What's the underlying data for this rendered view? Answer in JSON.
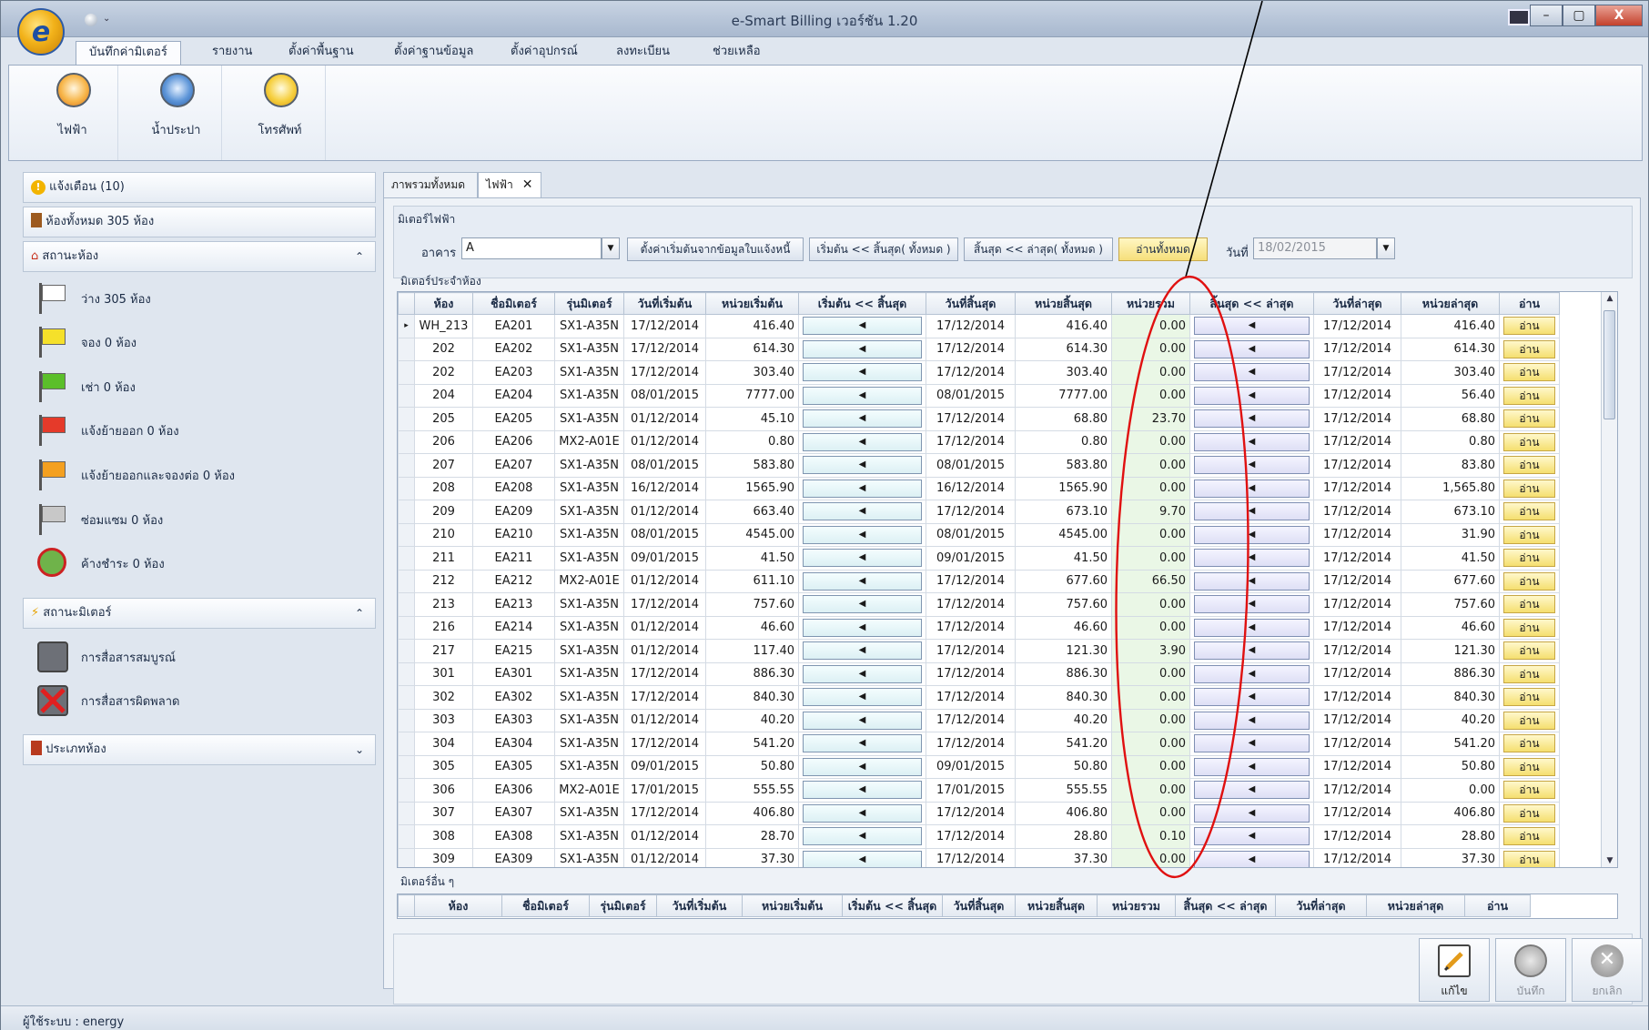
{
  "window": {
    "title": "e-Smart Billing เวอร์ชัน 1.20",
    "controls": {
      "minimize": "–",
      "maximize": "▢",
      "close": "X"
    }
  },
  "ribbon": {
    "tabs": [
      "บันทึกค่ามิเตอร์",
      "รายงาน",
      "ตั้งค่าพื้นฐาน",
      "ตั้งค่าฐานข้อมูล",
      "ตั้งค่าอุปกรณ์",
      "ลงทะเบียน",
      "ช่วยเหลือ"
    ],
    "buttons": [
      {
        "label": "ไฟฟ้า",
        "icon": "electric-meter-icon"
      },
      {
        "label": "น้ำประปา",
        "icon": "water-meter-icon"
      },
      {
        "label": "โทรศัพท์",
        "icon": "phone-meter-icon"
      }
    ]
  },
  "left": {
    "alerts": "แจ้งเตือน (10)",
    "rooms_total": "ห้องทั้งหมด 305 ห้อง",
    "room_status": {
      "title": "สถานะห้อง",
      "items": [
        {
          "label": "ว่าง 305 ห้อง",
          "color": "#ffffff"
        },
        {
          "label": "จอง 0 ห้อง",
          "color": "#f5e02a"
        },
        {
          "label": "เช่า 0 ห้อง",
          "color": "#5bbf2a"
        },
        {
          "label": "แจ้งย้ายออก 0 ห้อง",
          "color": "#e53a2a"
        },
        {
          "label": "แจ้งย้ายออกและจองต่อ 0 ห้อง",
          "color": "#f4a020"
        },
        {
          "label": "ซ่อมแซม 0 ห้อง",
          "color": "#c8c8c8"
        },
        {
          "label": "ค้างชำระ 0 ห้อง",
          "color": "#cc2222"
        }
      ]
    },
    "meter_status": {
      "title": "สถานะมิเตอร์",
      "items": [
        {
          "label": "การสื่อสารสมบูรณ์"
        },
        {
          "label": "การสื่อสารผิดพลาด"
        }
      ]
    },
    "room_type": {
      "title": "ประเภทห้อง"
    }
  },
  "doc_tabs": [
    {
      "label": "ภาพรวมทั้งหมด"
    },
    {
      "label": "ไฟฟ้า",
      "close": "✕"
    }
  ],
  "meter_panel": {
    "group_title": "มิเตอร์ไฟฟ้า",
    "building_label": "อาคาร",
    "building_value": "A",
    "btn_init": "ตั้งค่าเริ่มต้นจากข้อมูลใบแจ้งหนี้",
    "btn_start_end": "เริ่มต้น << สิ้นสุด( ทั้งหมด )",
    "btn_end_latest": "สิ้นสุด << ล่าสุด( ทั้งหมด )",
    "btn_read_all": "อ่านทั้งหมด",
    "date_label": "วันที่",
    "date_value": "18/02/2015"
  },
  "room_meters": {
    "title": "มิเตอร์ประจำห้อง",
    "columns": [
      "ห้อง",
      "ชื่อมิเตอร์",
      "รุ่นมิเตอร์",
      "วันที่เริ่มต้น",
      "หน่วยเริ่มต้น",
      "เริ่มต้น << สิ้นสุด",
      "วันที่สิ้นสุด",
      "หน่วยสิ้นสุด",
      "หน่วยรวม",
      "สิ้นสุด << ล่าสุด",
      "วันที่ล่าสุด",
      "หน่วยล่าสุด",
      "อ่าน"
    ],
    "arrow_glyph": "◀",
    "row_marker": "▸",
    "read_label": "อ่าน",
    "rows": [
      [
        "WH_213",
        "EA201",
        "SX1-A35N",
        "17/12/2014",
        "416.40",
        "17/12/2014",
        "416.40",
        "0.00",
        "17/12/2014",
        "416.40"
      ],
      [
        "202",
        "EA202",
        "SX1-A35N",
        "17/12/2014",
        "614.30",
        "17/12/2014",
        "614.30",
        "0.00",
        "17/12/2014",
        "614.30"
      ],
      [
        "202",
        "EA203",
        "SX1-A35N",
        "17/12/2014",
        "303.40",
        "17/12/2014",
        "303.40",
        "0.00",
        "17/12/2014",
        "303.40"
      ],
      [
        "204",
        "EA204",
        "SX1-A35N",
        "08/01/2015",
        "7777.00",
        "08/01/2015",
        "7777.00",
        "0.00",
        "17/12/2014",
        "56.40"
      ],
      [
        "205",
        "EA205",
        "SX1-A35N",
        "01/12/2014",
        "45.10",
        "17/12/2014",
        "68.80",
        "23.70",
        "17/12/2014",
        "68.80"
      ],
      [
        "206",
        "EA206",
        "MX2-A01E",
        "01/12/2014",
        "0.80",
        "17/12/2014",
        "0.80",
        "0.00",
        "17/12/2014",
        "0.80"
      ],
      [
        "207",
        "EA207",
        "SX1-A35N",
        "08/01/2015",
        "583.80",
        "08/01/2015",
        "583.80",
        "0.00",
        "17/12/2014",
        "83.80"
      ],
      [
        "208",
        "EA208",
        "SX1-A35N",
        "16/12/2014",
        "1565.90",
        "16/12/2014",
        "1565.90",
        "0.00",
        "17/12/2014",
        "1,565.80"
      ],
      [
        "209",
        "EA209",
        "SX1-A35N",
        "01/12/2014",
        "663.40",
        "17/12/2014",
        "673.10",
        "9.70",
        "17/12/2014",
        "673.10"
      ],
      [
        "210",
        "EA210",
        "SX1-A35N",
        "08/01/2015",
        "4545.00",
        "08/01/2015",
        "4545.00",
        "0.00",
        "17/12/2014",
        "31.90"
      ],
      [
        "211",
        "EA211",
        "SX1-A35N",
        "09/01/2015",
        "41.50",
        "09/01/2015",
        "41.50",
        "0.00",
        "17/12/2014",
        "41.50"
      ],
      [
        "212",
        "EA212",
        "MX2-A01E",
        "01/12/2014",
        "611.10",
        "17/12/2014",
        "677.60",
        "66.50",
        "17/12/2014",
        "677.60"
      ],
      [
        "213",
        "EA213",
        "SX1-A35N",
        "17/12/2014",
        "757.60",
        "17/12/2014",
        "757.60",
        "0.00",
        "17/12/2014",
        "757.60"
      ],
      [
        "216",
        "EA214",
        "SX1-A35N",
        "01/12/2014",
        "46.60",
        "17/12/2014",
        "46.60",
        "0.00",
        "17/12/2014",
        "46.60"
      ],
      [
        "217",
        "EA215",
        "SX1-A35N",
        "01/12/2014",
        "117.40",
        "17/12/2014",
        "121.30",
        "3.90",
        "17/12/2014",
        "121.30"
      ],
      [
        "301",
        "EA301",
        "SX1-A35N",
        "17/12/2014",
        "886.30",
        "17/12/2014",
        "886.30",
        "0.00",
        "17/12/2014",
        "886.30"
      ],
      [
        "302",
        "EA302",
        "SX1-A35N",
        "17/12/2014",
        "840.30",
        "17/12/2014",
        "840.30",
        "0.00",
        "17/12/2014",
        "840.30"
      ],
      [
        "303",
        "EA303",
        "SX1-A35N",
        "01/12/2014",
        "40.20",
        "17/12/2014",
        "40.20",
        "0.00",
        "17/12/2014",
        "40.20"
      ],
      [
        "304",
        "EA304",
        "SX1-A35N",
        "17/12/2014",
        "541.20",
        "17/12/2014",
        "541.20",
        "0.00",
        "17/12/2014",
        "541.20"
      ],
      [
        "305",
        "EA305",
        "SX1-A35N",
        "09/01/2015",
        "50.80",
        "09/01/2015",
        "50.80",
        "0.00",
        "17/12/2014",
        "50.80"
      ],
      [
        "306",
        "EA306",
        "MX2-A01E",
        "17/01/2015",
        "555.55",
        "17/01/2015",
        "555.55",
        "0.00",
        "17/12/2014",
        "0.00"
      ],
      [
        "307",
        "EA307",
        "SX1-A35N",
        "17/12/2014",
        "406.80",
        "17/12/2014",
        "406.80",
        "0.00",
        "17/12/2014",
        "406.80"
      ],
      [
        "308",
        "EA308",
        "SX1-A35N",
        "01/12/2014",
        "28.70",
        "17/12/2014",
        "28.80",
        "0.10",
        "17/12/2014",
        "28.80"
      ],
      [
        "309",
        "EA309",
        "SX1-A35N",
        "01/12/2014",
        "37.30",
        "17/12/2014",
        "37.30",
        "0.00",
        "17/12/2014",
        "37.30"
      ]
    ]
  },
  "other_meters": {
    "title": "มิเตอร์อื่น ๆ",
    "columns": [
      "ห้อง",
      "ชื่อมิเตอร์",
      "รุ่นมิเตอร์",
      "วันที่เริ่มต้น",
      "หน่วยเริ่มต้น",
      "เริ่มต้น << สิ้นสุด",
      "วันที่สิ้นสุด",
      "หน่วยสิ้นสุด",
      "หน่วยรวม",
      "สิ้นสุด << ล่าสุด",
      "วันที่ล่าสุด",
      "หน่วยล่าสุด",
      "อ่าน"
    ]
  },
  "actions": {
    "edit": "แก้ไข",
    "save": "บันทึก",
    "cancel": "ยกเลิก"
  },
  "status_bar": {
    "user": "ผู้ใช้ระบบ : energy"
  },
  "colors": {
    "total_column_bg": "#eaf7e6",
    "annotation": "#e01010"
  }
}
